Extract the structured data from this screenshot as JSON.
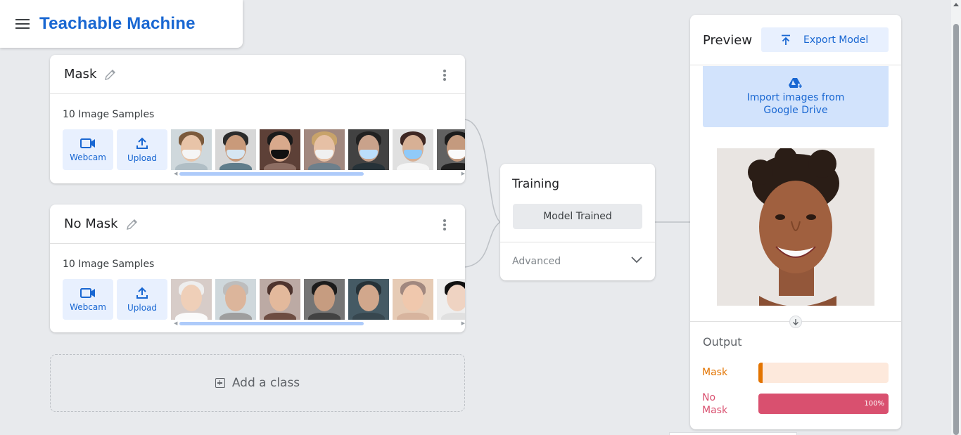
{
  "app": {
    "title": "Teachable Machine"
  },
  "classes": [
    {
      "name": "Mask",
      "samples_label": "10 Image Samples",
      "webcam_label": "Webcam",
      "upload_label": "Upload"
    },
    {
      "name": "No Mask",
      "samples_label": "10 Image Samples",
      "webcam_label": "Webcam",
      "upload_label": "Upload"
    }
  ],
  "add_class": {
    "label": "Add a class"
  },
  "training": {
    "title": "Training",
    "button_label": "Model Trained",
    "advanced_label": "Advanced"
  },
  "preview": {
    "title": "Preview",
    "export_label": "Export Model",
    "gdrive_line1": "Import images from",
    "gdrive_line2": "Google Drive",
    "output_title": "Output",
    "outputs": [
      {
        "label": "Mask",
        "value": 0,
        "percent_text": "",
        "color": "#e37400",
        "track": "#fde9dc"
      },
      {
        "label_line1": "No",
        "label_line2": "Mask",
        "value": 1.0,
        "percent_text": "100%",
        "color": "#d9506f",
        "track": "#fde2e8"
      }
    ]
  },
  "colors": {
    "accent": "#1967d2",
    "light_accent": "#e8f0fe",
    "background": "#e8eaed"
  }
}
